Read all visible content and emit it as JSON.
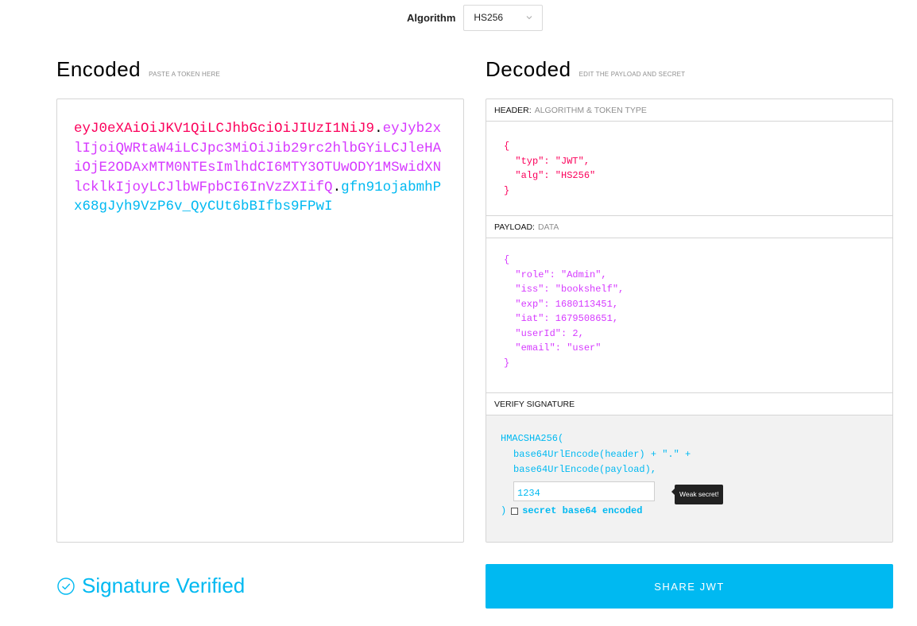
{
  "algorithm": {
    "label": "Algorithm",
    "value": "HS256"
  },
  "encoded": {
    "title": "Encoded",
    "subtitle": "PASTE A TOKEN HERE",
    "token": {
      "header": "eyJ0eXAiOiJKV1QiLCJhbGciOiJIUzI1NiJ9",
      "dot1": ".",
      "payload": "eyJyb2xlIjoiQWRtaW4iLCJpc3MiOiJib29rc2hlbGYiLCJleHAiOjE2ODAxMTM0NTEsImlhdCI6MTY3OTUwODY1MSwidXNlcklkIjoyLCJlbWFpbCI6InVzZXIifQ",
      "dot2": ".",
      "signature": "gfn91ojabmhPx68gJyh9VzP6v_QyCUt6bBIfbs9FPwI"
    }
  },
  "decoded": {
    "title": "Decoded",
    "subtitle": "EDIT THE PAYLOAD AND SECRET",
    "header_panel": {
      "label": "HEADER:",
      "desc": "ALGORITHM & TOKEN TYPE",
      "code": "{\n  \"typ\": \"JWT\",\n  \"alg\": \"HS256\"\n}"
    },
    "payload_panel": {
      "label": "PAYLOAD:",
      "desc": "DATA",
      "code": "{\n  \"role\": \"Admin\",\n  \"iss\": \"bookshelf\",\n  \"exp\": 1680113451,\n  \"iat\": 1679508651,\n  \"userId\": 2,\n  \"email\": \"user\"\n}"
    },
    "verify_panel": {
      "label": "VERIFY SIGNATURE",
      "fn_open": "HMACSHA256(",
      "line1": "base64UrlEncode(header) + \".\" +",
      "line2": "base64UrlEncode(payload),",
      "secret": "1234",
      "tooltip": "Weak secret!",
      "close_paren": ")",
      "b64_label": "secret base64 encoded",
      "b64_checked": false
    }
  },
  "status": {
    "text": "Signature Verified",
    "color": "#00b9f1"
  },
  "share_button": {
    "label": "SHARE JWT"
  },
  "colors": {
    "header": "#fb015b",
    "payload": "#d63aff",
    "signature": "#00b9f1"
  }
}
